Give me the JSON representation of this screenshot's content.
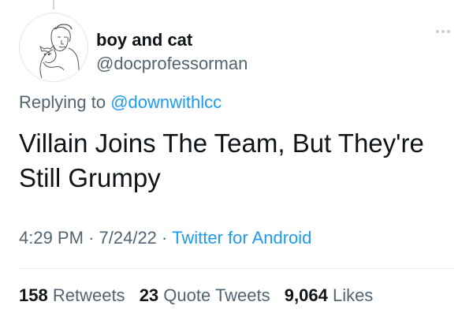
{
  "tweet": {
    "display_name": "boy and cat",
    "handle": "@docprofessorman",
    "replying_prefix": "Replying to ",
    "replying_to": "@downwithlcc",
    "text": "Villain Joins The Team, But They're Still Grumpy",
    "time": "4:29 PM",
    "date": "7/24/22",
    "separator": "·",
    "source": "Twitter for Android",
    "avatar_icon": "sketch-boy-holding-cat-avatar",
    "more_icon": "more-options-icon"
  },
  "stats": {
    "retweets_count": "158",
    "retweets_label": "Retweets",
    "quote_count": "23",
    "quote_label": "Quote Tweets",
    "likes_count": "9,064",
    "likes_label": "Likes"
  },
  "colors": {
    "accent": "#1d9bf0",
    "secondary_text": "#536471",
    "primary_text": "#0f1419"
  }
}
